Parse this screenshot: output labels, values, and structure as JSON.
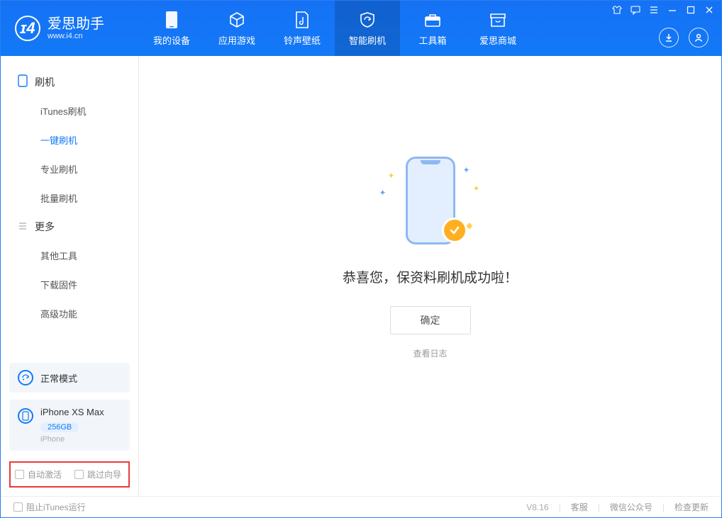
{
  "app": {
    "title": "爱思助手",
    "subtitle": "www.i4.cn"
  },
  "nav": {
    "items": [
      {
        "id": "device",
        "label": "我的设备"
      },
      {
        "id": "apps",
        "label": "应用游戏"
      },
      {
        "id": "ringtones",
        "label": "铃声壁纸"
      },
      {
        "id": "flash",
        "label": "智能刷机"
      },
      {
        "id": "toolbox",
        "label": "工具箱"
      },
      {
        "id": "store",
        "label": "爱思商城"
      }
    ]
  },
  "sidebar": {
    "section_flash": "刷机",
    "flash_items": [
      {
        "label": "iTunes刷机"
      },
      {
        "label": "一键刷机"
      },
      {
        "label": "专业刷机"
      },
      {
        "label": "批量刷机"
      }
    ],
    "section_more": "更多",
    "more_items": [
      {
        "label": "其他工具"
      },
      {
        "label": "下载固件"
      },
      {
        "label": "高级功能"
      }
    ],
    "mode_label": "正常模式",
    "device_name": "iPhone XS Max",
    "device_capacity": "256GB",
    "device_type": "iPhone",
    "checkbox_auto_activate": "自动激活",
    "checkbox_skip_guide": "跳过向导"
  },
  "main": {
    "success_message": "恭喜您，保资料刷机成功啦！",
    "confirm_button": "确定",
    "view_log": "查看日志"
  },
  "footer": {
    "block_itunes": "阻止iTunes运行",
    "version": "V8.16",
    "links": [
      {
        "label": "客服"
      },
      {
        "label": "微信公众号"
      },
      {
        "label": "检查更新"
      }
    ]
  }
}
